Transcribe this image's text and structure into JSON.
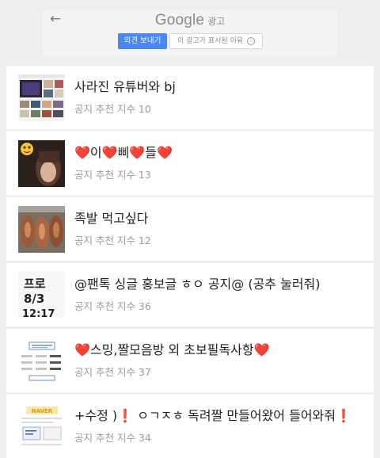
{
  "ad": {
    "brand": "Google",
    "brand_suffix": "광고",
    "feedback_label": "의견 보내기",
    "why_label": "이 광고가 표시된 이유",
    "info_glyph": "i",
    "back_glyph": "←"
  },
  "posts": [
    {
      "title": "사라진 유튜버와 bj",
      "meta": "공지 추천 지수 10",
      "thumb_icon": "video-grid-thumbnail"
    },
    {
      "title_parts": [
        "❤️",
        "이",
        "❤️",
        "삐",
        "❤️",
        "들",
        "❤️"
      ],
      "meta": "공지 추천 지수 13",
      "thumb_icon": "portrait-thumbnail"
    },
    {
      "title": "족발 먹고싶다",
      "meta": "공지 추천 지수 12",
      "thumb_icon": "food-thumbnail"
    },
    {
      "title": "@팬톡 싱글 홍보글 ㅎㅇ 공지@ (공추 눌러줘)",
      "meta": "공지 추천 지수 36",
      "thumb_icon": "handwriting-thumbnail",
      "thumb_text": [
        "프로",
        "8/3",
        "12:17"
      ]
    },
    {
      "title_parts": [
        "❤️",
        "스밍,짤모음방 외 초보필독사항",
        "❤️"
      ],
      "meta": "공지 추천 지수 37",
      "thumb_icon": "document-thumbnail"
    },
    {
      "title_parts": [
        "+수정 )",
        "❗",
        " ㅇㄱㅈㅎ 독려짤 만들어왔어 들어와줘",
        "❗"
      ],
      "meta": "공지 추천 지수 34",
      "thumb_icon": "banner-thumbnail",
      "thumb_text": [
        "NAVER"
      ]
    }
  ]
}
